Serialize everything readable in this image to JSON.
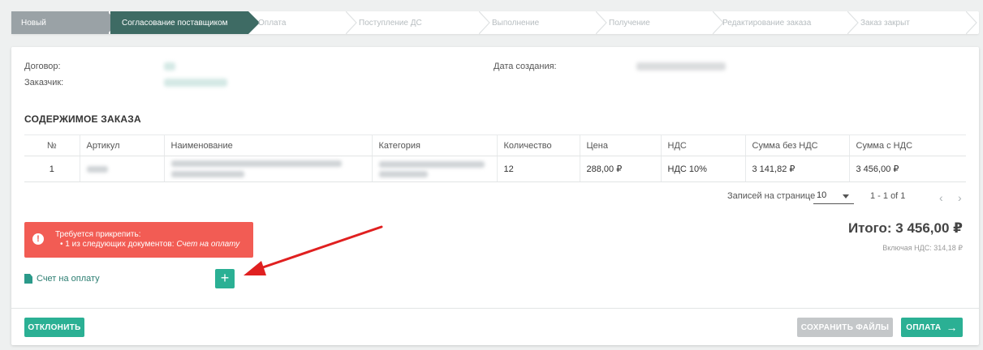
{
  "stepper": {
    "steps": [
      {
        "label": "Новый",
        "state": "done"
      },
      {
        "label": "Согласование поставщиком",
        "state": "current"
      },
      {
        "label": "Оплата",
        "state": "pending"
      },
      {
        "label": "Поступление ДС",
        "state": "pending"
      },
      {
        "label": "Выполнение",
        "state": "pending"
      },
      {
        "label": "Получение",
        "state": "pending"
      },
      {
        "label": "Редактирование заказа",
        "state": "pending"
      },
      {
        "label": "Заказ закрыт",
        "state": "pending"
      }
    ]
  },
  "info": {
    "contract_label": "Договор:",
    "customer_label": "Заказчик:",
    "created_label": "Дата создания:"
  },
  "order": {
    "section_title": "СОДЕРЖИМОЕ ЗАКАЗА",
    "columns": [
      "№",
      "Артикул",
      "Наименование",
      "Категория",
      "Количество",
      "Цена",
      "НДС",
      "Сумма без НДС",
      "Сумма с НДС"
    ],
    "rows": [
      {
        "n": "1",
        "quantity": "12",
        "price": "288,00 ₽",
        "vat": "НДС 10%",
        "sum_no_vat": "3 141,82 ₽",
        "sum_vat": "3 456,00 ₽"
      }
    ]
  },
  "pagination": {
    "per_page_label": "Записей на странице",
    "per_page_value": "10",
    "range": "1 - 1 of 1"
  },
  "alert": {
    "title": "Требуется прикрепить:",
    "line_prefix": "1 из следующих документов:",
    "line_doc": "Счет на оплату"
  },
  "totals": {
    "total": "Итого: 3 456,00 ₽",
    "vat_note": "Включая НДС: 314,18 ₽"
  },
  "documents": {
    "invoice_label": "Счет на оплату",
    "add_symbol": "+"
  },
  "actions": {
    "reject": "ОТКЛОНИТЬ",
    "save_files": "СОХРАНИТЬ ФАЙЛЫ",
    "pay": "ОПЛАТА",
    "pay_arrow": "→"
  },
  "colors": {
    "accent": "#2bb094",
    "current_step": "#3e6b64",
    "alert": "#f25c54",
    "annotation_arrow": "#e02020"
  }
}
